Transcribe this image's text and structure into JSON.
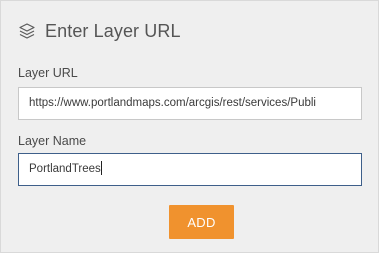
{
  "header": {
    "icon": "layers-icon",
    "title": "Enter Layer URL"
  },
  "form": {
    "url_label": "Layer URL",
    "url_value": "https://www.portlandmaps.com/arcgis/rest/services/Publi",
    "name_label": "Layer Name",
    "name_value": "PortlandTrees",
    "add_label": "ADD"
  },
  "colors": {
    "panel_bg": "#efefef",
    "accent": "#f0922e",
    "focus_border": "#3e5f8a"
  }
}
